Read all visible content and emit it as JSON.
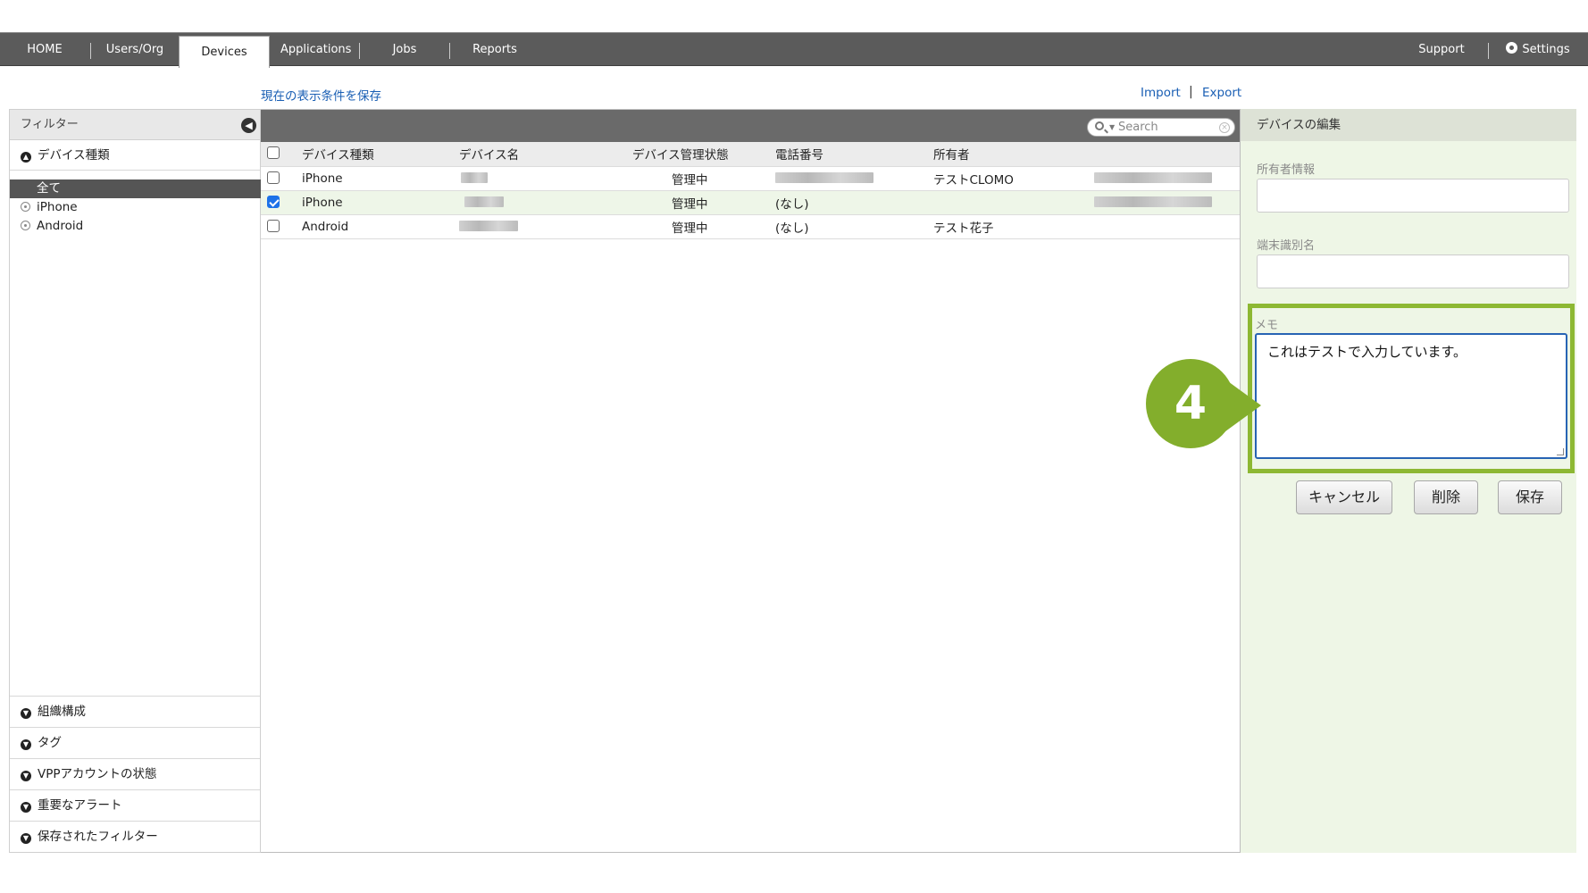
{
  "nav": {
    "tabs": [
      {
        "label": "HOME"
      },
      {
        "label": "Users/Org"
      },
      {
        "label": "Devices"
      },
      {
        "label": "Applications"
      },
      {
        "label": "Jobs"
      },
      {
        "label": "Reports"
      }
    ],
    "active_tab": "Devices",
    "support_label": "Support",
    "settings_label": "Settings"
  },
  "links": {
    "save_view": "現在の表示条件を保存",
    "import": "Import",
    "export": "Export",
    "separator": "|"
  },
  "filter": {
    "title": "フィルター",
    "device_type_section": "デバイス種類",
    "items": [
      {
        "label": "全て",
        "selected": true
      },
      {
        "label": "iPhone"
      },
      {
        "label": "Android"
      }
    ],
    "bottom_sections": [
      {
        "label": "組織構成"
      },
      {
        "label": "タグ"
      },
      {
        "label": "VPPアカウントの状態"
      },
      {
        "label": "重要なアラート"
      },
      {
        "label": "保存されたフィルター"
      }
    ]
  },
  "table": {
    "search_placeholder": "Search",
    "headers": [
      "デバイス種類",
      "デバイス名",
      "デバイス管理状態",
      "電話番号",
      "所有者"
    ],
    "rows": [
      {
        "type": "iPhone",
        "status": "管理中",
        "phone": "",
        "owner": "テストCLOMO",
        "checked": false
      },
      {
        "type": "iPhone",
        "status": "管理中",
        "phone": "(なし)",
        "owner": "",
        "checked": true
      },
      {
        "type": "Android",
        "status": "管理中",
        "phone": "(なし)",
        "owner": "テスト花子",
        "checked": false
      }
    ]
  },
  "edit": {
    "title": "デバイスの編集",
    "owner_info_label": "所有者情報",
    "owner_info_value": "",
    "device_id_label": "端末識別名",
    "device_id_value": "",
    "memo_label": "メモ",
    "memo_value": "これはテストで入力しています。",
    "cancel_label": "キャンセル",
    "delete_label": "削除",
    "save_label": "保存"
  },
  "callout": {
    "step_number": "4",
    "color": "#83ae2c"
  },
  "colors": {
    "nav_bg": "#5b5b5b",
    "link": "#1a5fb4",
    "edit_panel_bg": "#eef6e6",
    "highlight_frame": "#8db833",
    "checkbox_checked": "#1d72e8"
  }
}
